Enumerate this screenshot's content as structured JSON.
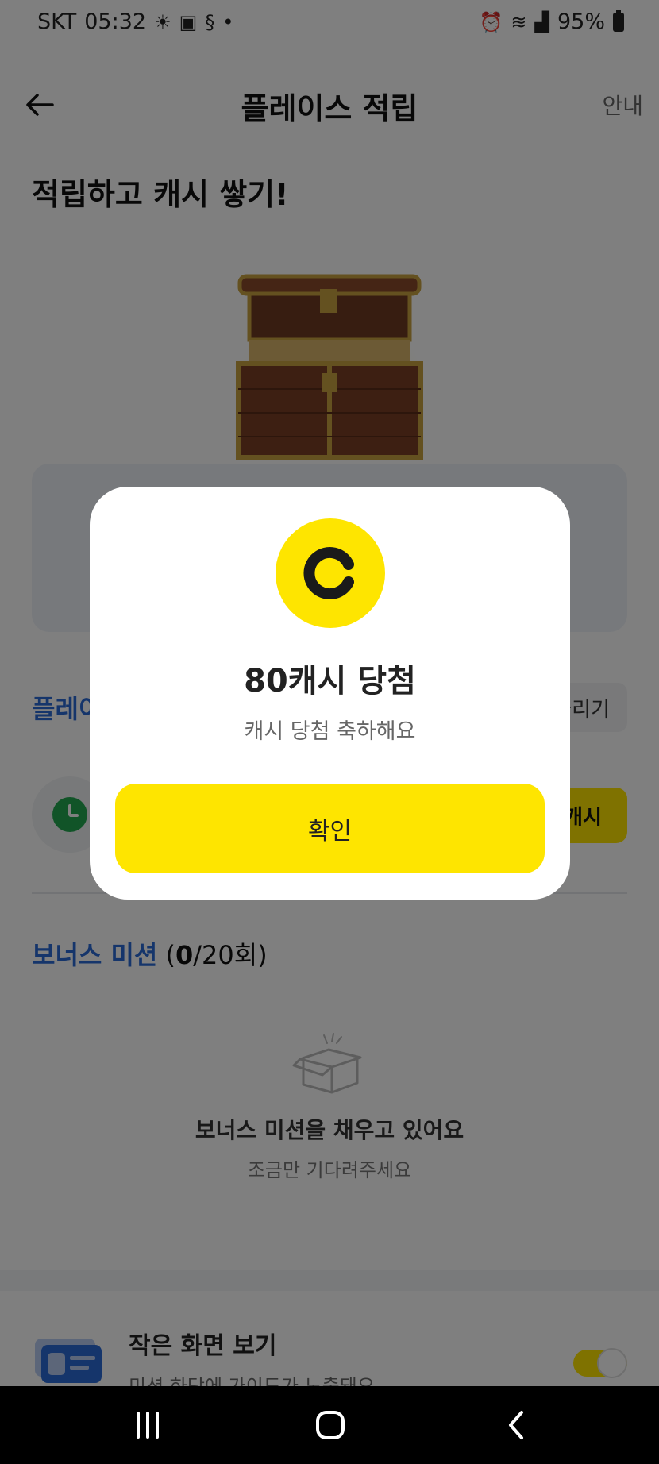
{
  "status_bar": {
    "carrier": "SKT",
    "time": "05:32",
    "battery": "95%"
  },
  "header": {
    "title": "플레이스 적립",
    "info_label": "안내"
  },
  "page": {
    "heading": "적립하고 캐시 쌓기!",
    "section_title": "플레이",
    "share_label": "늘리기",
    "cash_button_label": "캐시",
    "bonus": {
      "title": "보너스 미션",
      "count_done": "0",
      "count_rest": "/20회)",
      "open_paren": "("
    },
    "empty": {
      "title": "보너스 미션을 채우고 있어요",
      "subtitle": "조금만 기다려주세요"
    },
    "small_screen": {
      "title": "작은 화면 보기",
      "subtitle": "미션 하단에 가이드가 노출돼요",
      "toggle_on": true
    }
  },
  "modal": {
    "title": "80캐시 당첨",
    "subtitle": "캐시 당첨 축하해요",
    "confirm_label": "확인"
  },
  "colors": {
    "accent_yellow": "#fee500",
    "accent_blue": "#2a6bd6"
  }
}
